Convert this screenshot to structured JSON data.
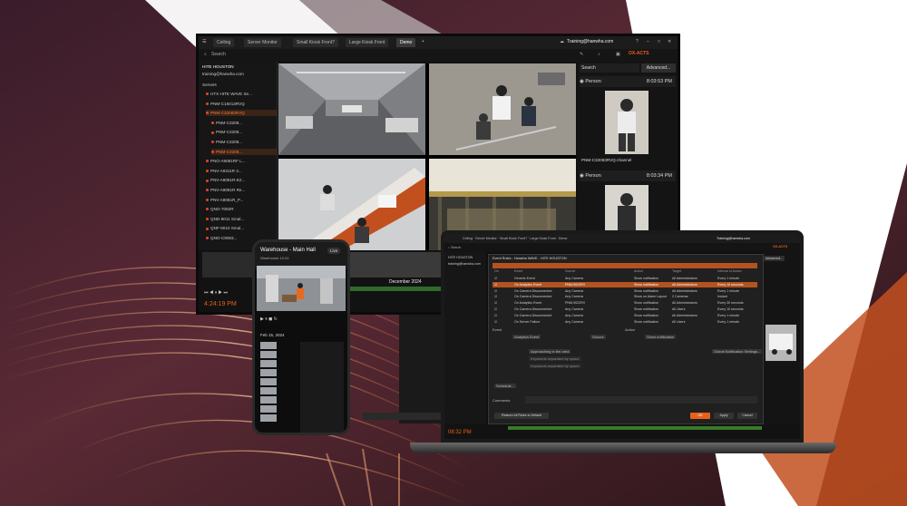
{
  "monitor": {
    "tabs": [
      "Ceiling",
      "Server Monitor",
      "Small Kiosk Front?",
      "Large Kiosk Front",
      "Demo"
    ],
    "account": "Training@hanwha.com",
    "search_placeholder": "Search",
    "site": "HITE HOUSTON",
    "user": "training@hanwha.com",
    "servers_label": "Servers",
    "tree": [
      "HTX HITE WAVE Se...",
      "PNM-C16013RVQ",
      "PNM-C32083RVQ",
      "PNM-C3208...",
      "PNM-C3208...",
      "PNM-C3208...",
      "PNM-C3208...",
      "PNO-A9081RF L...",
      "PNV-A9311R 3...",
      "PNV-A9081R-E2...",
      "PNV-A9081R Re...",
      "PNV-A9081R_P...",
      "QNO-7082R",
      "QND-8011 Smal...",
      "QNF-9010 Smal...",
      "QNO-C9083..."
    ],
    "right_search": "Search",
    "advanced_label": "Advanced...",
    "events": [
      {
        "label": "Person",
        "time": "8:03:53 PM",
        "caption": "PNM-C32083RVQ-channel"
      },
      {
        "label": "Person",
        "time": "8:03:34 PM"
      }
    ],
    "timeline_month": "December 2024",
    "clock": "4:24:19 PM",
    "brand": "OX-ACTS"
  },
  "phone": {
    "title": "Warehouse - Main Hall",
    "subtitle": "Warehouse 10:24",
    "live_label": "Live",
    "date": "Feb 15, 2024"
  },
  "laptop": {
    "account": "Training@hanwha.com",
    "brand": "OX-ACTS",
    "site": "HITE HOUSTON",
    "user": "training@hanwha.com",
    "advanced_label": "Advanced...",
    "dialog_title": "Event Rules - Hanwha WAVE - HITE HOUSTON",
    "columns": [
      "On",
      "Event",
      "Source",
      "Action",
      "Target",
      "Interval of Action"
    ],
    "rules": [
      {
        "event": "Generic Event",
        "source": "Any Camera",
        "action": "Show notification",
        "target": "All Administrators",
        "interval": "Every 1 minute"
      },
      {
        "event": "On Analytics Event",
        "source": "PNM-9022RV",
        "action": "Show notification",
        "target": "All Administrators",
        "interval": "Every 10 seconds"
      },
      {
        "event": "On Camera Disconnected",
        "source": "Any Camera",
        "action": "Show notification",
        "target": "All Administrators",
        "interval": "Every 1 minute"
      },
      {
        "event": "On Camera Disconnected",
        "source": "Any Camera",
        "action": "Show on Alarm Layout",
        "target": "2 Cameras",
        "interval": "Instant"
      },
      {
        "event": "On Analytics Event",
        "source": "PNM-9022RV",
        "action": "Show notification",
        "target": "All Administrators",
        "interval": "Every 30 seconds"
      },
      {
        "event": "On Camera Disconnected",
        "source": "Any Camera",
        "action": "Show notification",
        "target": "All Users",
        "interval": "Every 10 seconds"
      },
      {
        "event": "On Camera Disconnected",
        "source": "Any Camera",
        "action": "Show notification",
        "target": "All Administrators",
        "interval": "Every 1 minute"
      },
      {
        "event": "On Server Failure",
        "source": "Any Camera",
        "action": "Show notification",
        "target": "All Users",
        "interval": "Every 1 minute"
      }
    ],
    "event_label": "Event",
    "action_label": "Action",
    "event_when": "Analytics Event",
    "event_occurs": "Occurs",
    "action_type": "Show notification",
    "event_type": "Approaching in the area",
    "caption_contains": "Keywords separated by space",
    "description_contains": "Keywords separated by space",
    "schedule_label": "Schedule...",
    "global_settings": "Global Notification Settings...",
    "comments_label": "Comments",
    "reset_label": "Restore All Rules to Default",
    "ok_label": "OK",
    "apply_label": "Apply",
    "cancel_label": "Cancel",
    "clock": "08:32 PM"
  },
  "colors": {
    "accent": "#e8601c",
    "bg": "#111111"
  }
}
